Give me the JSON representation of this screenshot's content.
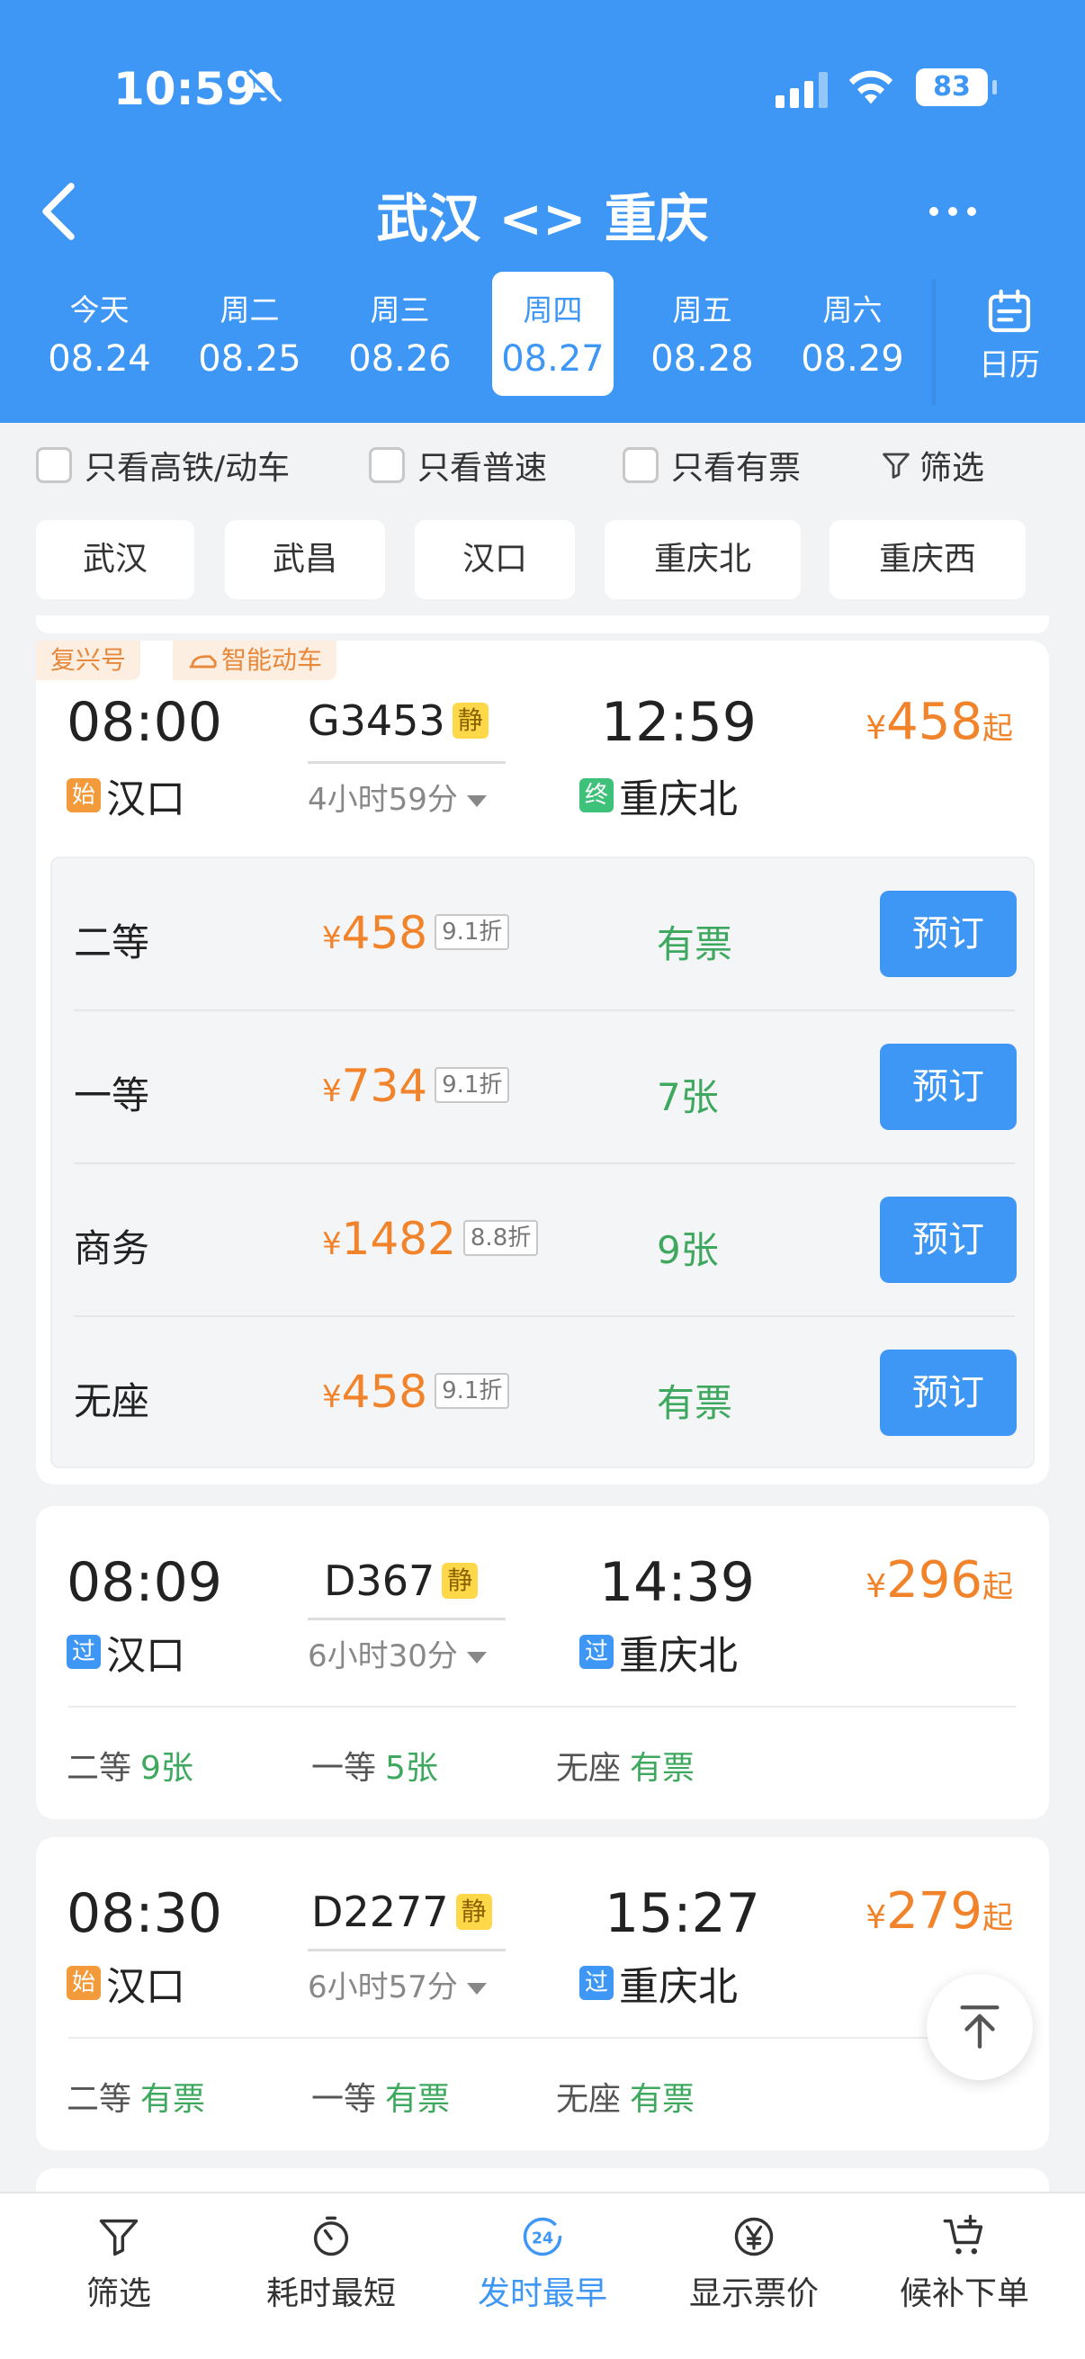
{
  "status": {
    "time": "10:59",
    "battery": "83"
  },
  "nav": {
    "title": "武汉 <> 重庆"
  },
  "dates": [
    {
      "week": "今天",
      "date": "08.24"
    },
    {
      "week": "周二",
      "date": "08.25"
    },
    {
      "week": "周三",
      "date": "08.26"
    },
    {
      "week": "周四",
      "date": "08.27"
    },
    {
      "week": "周五",
      "date": "08.28"
    },
    {
      "week": "周六",
      "date": "08.29"
    }
  ],
  "calendar_label": "日历",
  "filters": {
    "high_speed": "只看高铁/动车",
    "normal": "只看普速",
    "available": "只看有票",
    "filter": "筛选"
  },
  "stations": [
    "武汉",
    "武昌",
    "汉口",
    "重庆北",
    "重庆西"
  ],
  "trains": [
    {
      "tags": [
        "复兴号",
        "智能动车"
      ],
      "depart": "08:00",
      "train_no": "G3453",
      "quiet": "静",
      "arrive": "12:59",
      "price_yen": "¥",
      "price": "458",
      "price_suffix": "起",
      "from_badge": "始",
      "from_station": "汉口",
      "duration": "4小时59分",
      "to_badge": "终",
      "to_station": "重庆北",
      "seats": [
        {
          "name": "二等",
          "yen": "¥",
          "price": "458",
          "discount": "9.1折",
          "avail": "有票",
          "book": "预订"
        },
        {
          "name": "一等",
          "yen": "¥",
          "price": "734",
          "discount": "9.1折",
          "avail": "7张",
          "book": "预订"
        },
        {
          "name": "商务",
          "yen": "¥",
          "price": "1482",
          "discount": "8.8折",
          "avail": "9张",
          "book": "预订"
        },
        {
          "name": "无座",
          "yen": "¥",
          "price": "458",
          "discount": "9.1折",
          "avail": "有票",
          "book": "预订"
        }
      ]
    },
    {
      "depart": "08:09",
      "train_no": "D367",
      "quiet": "静",
      "arrive": "14:39",
      "price_yen": "¥",
      "price": "296",
      "price_suffix": "起",
      "from_badge": "过",
      "from_station": "汉口",
      "duration": "6小时30分",
      "to_badge": "过",
      "to_station": "重庆北",
      "summary": [
        {
          "name": "二等",
          "avail": "9张"
        },
        {
          "name": "一等",
          "avail": "5张"
        },
        {
          "name": "无座",
          "avail": "有票"
        }
      ]
    },
    {
      "depart": "08:30",
      "train_no": "D2277",
      "quiet": "静",
      "arrive": "15:27",
      "price_yen": "¥",
      "price": "279",
      "price_suffix": "起",
      "from_badge": "始",
      "from_station": "汉口",
      "duration": "6小时57分",
      "to_badge": "过",
      "to_station": "重庆北",
      "summary": [
        {
          "name": "二等",
          "avail": "有票"
        },
        {
          "name": "一等",
          "avail": "有票"
        },
        {
          "name": "无座",
          "avail": "有票"
        }
      ]
    }
  ],
  "tabs": [
    "筛选",
    "耗时最短",
    "发时最早",
    "显示票价",
    "候补下单"
  ],
  "tab_badge": "24",
  "colors": {
    "primary": "#3e97f5",
    "price": "#f1832b",
    "available": "#3ea85e"
  }
}
